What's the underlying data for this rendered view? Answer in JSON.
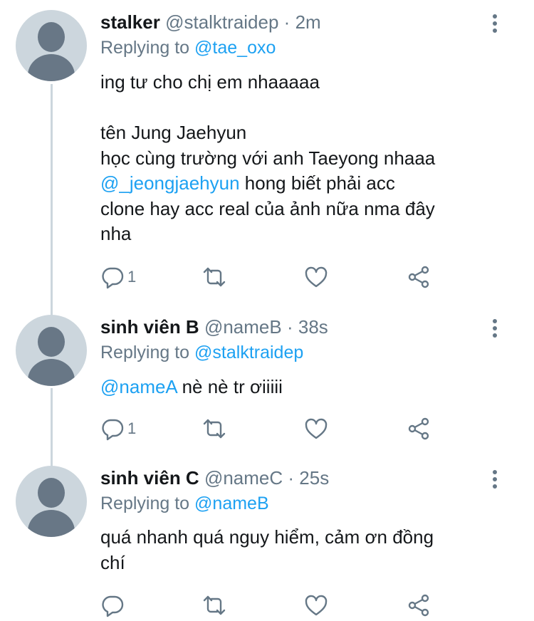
{
  "tweets": [
    {
      "name": "stalker",
      "handle": "@stalktraidep",
      "separator": "·",
      "time": "2m",
      "replying_prefix": "Replying to",
      "replying_to": "@tae_oxo",
      "lines": [
        "ing tư cho chị em nhaaaaa",
        "",
        "tên Jung Jaehyun",
        "học cùng trường với anh Taeyong nhaaa"
      ],
      "mention_line": {
        "mention": "@_jeongjaehyun",
        "rest": " hong biết phải acc"
      },
      "tail_lines": [
        "clone hay acc real của ảnh nữa nma đây",
        "nha"
      ],
      "reply_count": "1",
      "icons": {
        "reply": "reply-icon",
        "retweet": "retweet-icon",
        "like": "heart-icon",
        "share": "share-icon",
        "more": "more-vertical-icon"
      }
    },
    {
      "name": "sinh viên B",
      "handle": "@nameB",
      "separator": "·",
      "time": "38s",
      "replying_prefix": "Replying to",
      "replying_to": "@stalktraidep",
      "mention_line": {
        "mention": "@nameA",
        "rest": " nè nè tr ơiiiii"
      },
      "reply_count": "1"
    },
    {
      "name": "sinh viên C",
      "handle": "@nameC",
      "separator": "·",
      "time": "25s",
      "replying_prefix": "Replying to",
      "replying_to": "@nameB",
      "lines": [
        "quá nhanh quá nguy hiểm, cảm ơn đồng",
        "chí"
      ],
      "reply_count": ""
    }
  ],
  "colors": {
    "accent": "#1da1f2",
    "muted": "#657786",
    "text": "#14171a",
    "avatar_bg": "#ccd6dd",
    "avatar_fg": "#687786"
  }
}
